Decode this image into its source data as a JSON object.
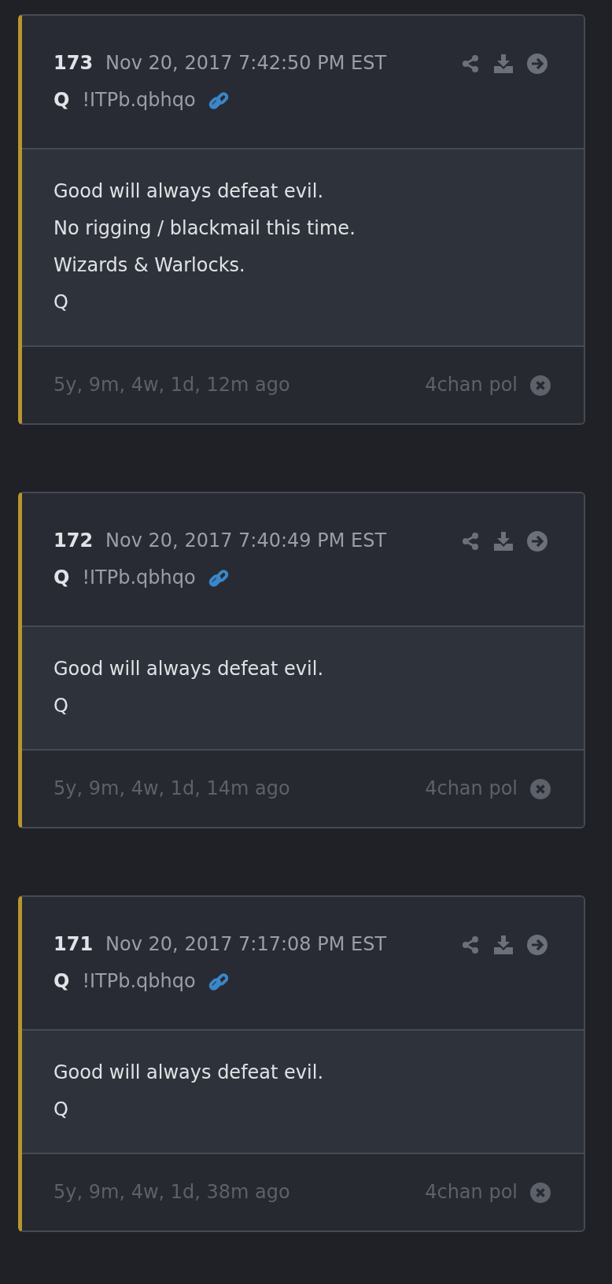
{
  "posts": [
    {
      "number": "173",
      "timestamp": "Nov 20, 2017 7:42:50 PM EST",
      "author": "Q",
      "tripcode": "!ITPb.qbhqo",
      "body": [
        "Good will always defeat evil.",
        "No rigging / blackmail this time.",
        "Wizards & Warlocks.",
        "Q"
      ],
      "age": "5y, 9m, 4w, 1d, 12m ago",
      "source": "4chan pol"
    },
    {
      "number": "172",
      "timestamp": "Nov 20, 2017 7:40:49 PM EST",
      "author": "Q",
      "tripcode": "!ITPb.qbhqo",
      "body": [
        "Good will always defeat evil.",
        "Q"
      ],
      "age": "5y, 9m, 4w, 1d, 14m ago",
      "source": "4chan pol"
    },
    {
      "number": "171",
      "timestamp": "Nov 20, 2017 7:17:08 PM EST",
      "author": "Q",
      "tripcode": "!ITPb.qbhqo",
      "body": [
        "Good will always defeat evil.",
        "Q"
      ],
      "age": "5y, 9m, 4w, 1d, 38m ago",
      "source": "4chan pol"
    }
  ]
}
